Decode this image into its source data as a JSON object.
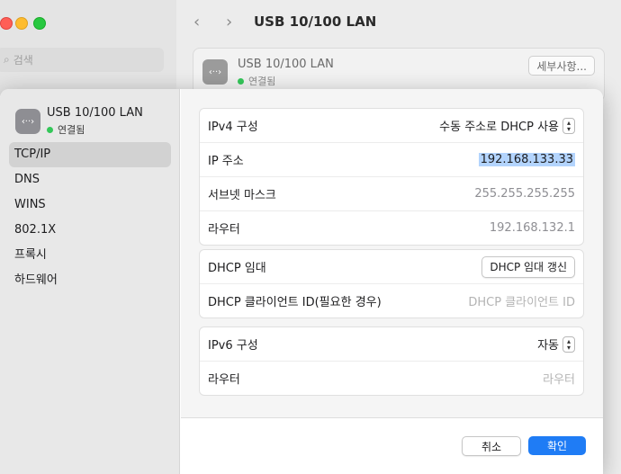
{
  "window": {
    "title": "USB 10/100 LAN",
    "search_placeholder": "검색",
    "device_card": {
      "name": "USB 10/100 LAN",
      "status": "연결됨",
      "details_button": "세부사항..."
    }
  },
  "sheet": {
    "device": {
      "name": "USB 10/100 LAN",
      "status": "연결됨",
      "icon": "ethernet-icon"
    },
    "tabs": [
      "TCP/IP",
      "DNS",
      "WINS",
      "802.1X",
      "프록시",
      "하드웨어"
    ],
    "active_tab": "TCP/IP",
    "ipv4": {
      "config_label": "IPv4 구성",
      "config_value": "수동 주소로 DHCP 사용",
      "ip_label": "IP 주소",
      "ip_value": "192.168.133.33",
      "subnet_label": "서브넷 마스크",
      "subnet_value": "255.255.255.255",
      "router_label": "라우터",
      "router_value": "192.168.132.1"
    },
    "dhcp": {
      "lease_label": "DHCP 임대",
      "renew_button": "DHCP 임대 갱신",
      "client_id_label": "DHCP 클라이언트 ID(필요한 경우)",
      "client_id_placeholder": "DHCP 클라이언트 ID"
    },
    "ipv6": {
      "config_label": "IPv6 구성",
      "config_value": "자동",
      "router_label": "라우터",
      "router_placeholder": "라우터"
    },
    "buttons": {
      "cancel": "취소",
      "ok": "확인"
    }
  },
  "colors": {
    "accent": "#1f7cf5",
    "status_green": "#34c759",
    "selection": "#b3d4fd"
  }
}
